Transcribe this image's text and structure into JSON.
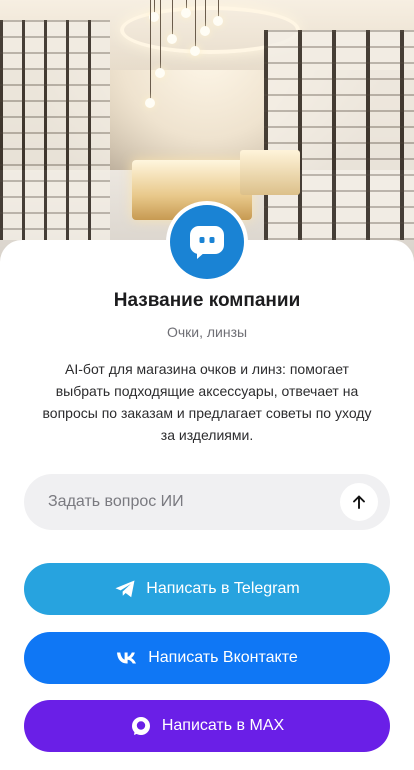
{
  "company": {
    "name": "Название компании",
    "category": "Очки, линзы",
    "description": "AI-бот для магазина очков и линз: помогает выбрать подходящие аксессуары, отвечает на вопросы по заказам и предлагает советы по уходу за изделиями."
  },
  "ask": {
    "placeholder": "Задать вопрос ИИ",
    "send_icon": "arrow-up-icon"
  },
  "buttons": {
    "telegram": {
      "label": "Написать в Telegram",
      "icon": "telegram-icon",
      "color": "#27a3df"
    },
    "vk": {
      "label": "Написать Вконтакте",
      "icon": "vk-icon",
      "color": "#0f77f5"
    },
    "max": {
      "label": "Написать в MAX",
      "icon": "max-icon",
      "color": "#6a1fe7"
    }
  },
  "colors": {
    "logo_bg": "#1a83d4",
    "input_bg": "#f0f0f2"
  }
}
